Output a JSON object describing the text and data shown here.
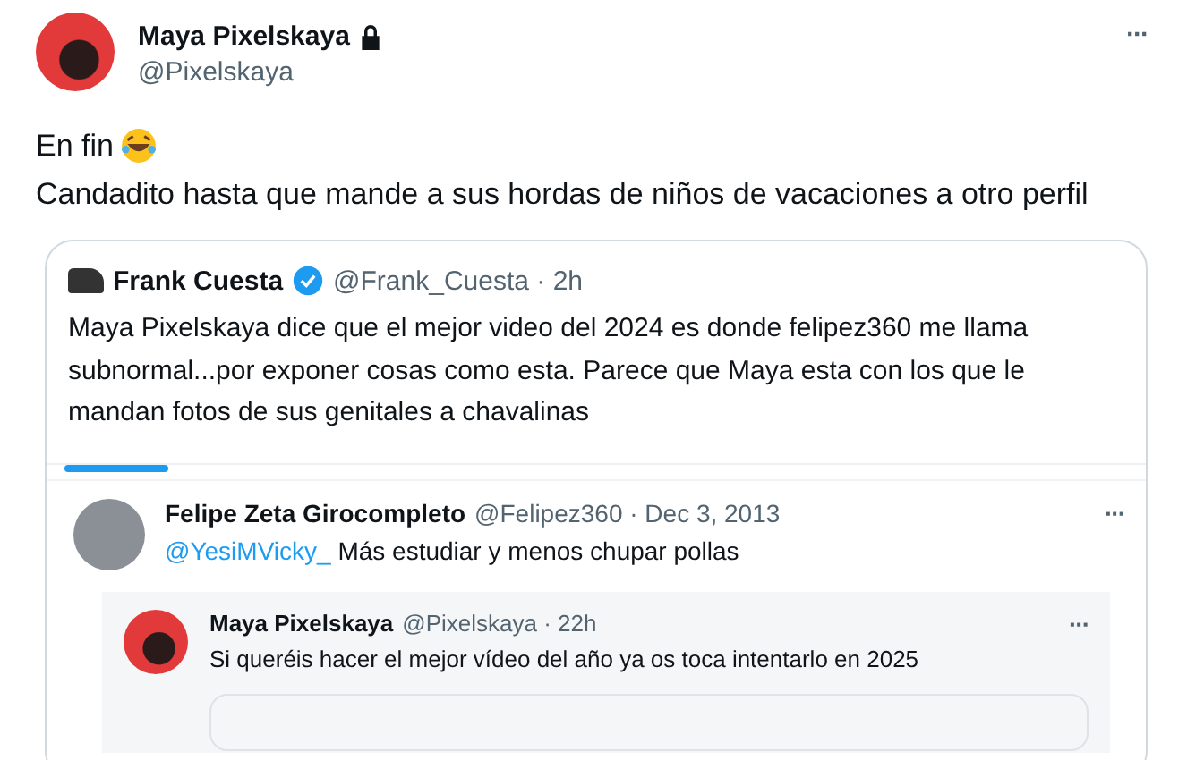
{
  "tweet": {
    "author": {
      "name": "Maya Pixelskaya",
      "handle": "@Pixelskaya",
      "protected": true
    },
    "text_lines": [
      "En fin",
      "Candadito hasta que mande a sus hordas de niños de vacaciones a otro perfil"
    ],
    "more": "···",
    "quote": {
      "author": {
        "name": "Frank Cuesta",
        "handle": "@Frank_Cuesta",
        "verified": true,
        "time": "· 2h"
      },
      "text": "Maya Pixelskaya dice que el mejor video del 2024 es donde felipez360 me llama subnormal...por exponer cosas como esta. Parece que Maya esta con los que le mandan fotos de sus genitales a chavalinas",
      "screenshot": {
        "post": {
          "name": "Felipe Zeta Girocompleto",
          "handle": "@Felipez360",
          "time": "· Dec 3, 2013",
          "mention": "@YesiMVicky_",
          "text": "Más estudiar y menos chupar pollas",
          "more": "···"
        },
        "nested": {
          "name": "Maya Pixelskaya",
          "handle": "@Pixelskaya",
          "time": "· 22h",
          "text": "Si queréis hacer el mejor vídeo del año ya os toca intentarlo en 2025",
          "more": "···"
        }
      }
    }
  }
}
